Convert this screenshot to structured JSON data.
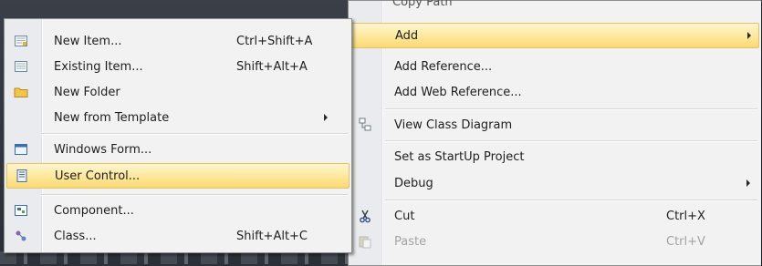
{
  "submenu": {
    "items": [
      {
        "label": "New Item...",
        "shortcut": "Ctrl+Shift+A",
        "icon": "new-item-icon"
      },
      {
        "label": "Existing Item...",
        "shortcut": "Shift+Alt+A",
        "icon": "existing-item-icon"
      },
      {
        "label": "New Folder",
        "icon": "folder-icon"
      },
      {
        "label": "New from Template",
        "has_submenu": true
      },
      {
        "label": "Windows Form...",
        "icon": "windows-form-icon"
      },
      {
        "label": "User Control...",
        "icon": "user-control-icon",
        "highlighted": true
      },
      {
        "label": "Component...",
        "icon": "component-icon"
      },
      {
        "label": "Class...",
        "shortcut": "Shift+Alt+C",
        "icon": "class-icon"
      }
    ]
  },
  "context_menu": {
    "cut_off_top_label": "Copy Path",
    "items": [
      {
        "label": "Add",
        "has_submenu": true,
        "highlighted": true
      },
      {
        "label": "Add Reference..."
      },
      {
        "label": "Add Web Reference..."
      },
      {
        "label": "View Class Diagram",
        "icon": "class-diagram-icon"
      },
      {
        "label": "Set as StartUp Project"
      },
      {
        "label": "Debug",
        "has_submenu": true
      },
      {
        "label": "Cut",
        "shortcut": "Ctrl+X",
        "icon": "scissors-icon"
      },
      {
        "label": "Paste",
        "shortcut": "Ctrl+V",
        "icon": "paste-icon",
        "disabled": true
      }
    ]
  },
  "colors": {
    "highlight": "#fde79a",
    "menu_background": "#f2f2f2",
    "gutter": "#e9ebee",
    "disabled_text": "#a3a3a3"
  }
}
